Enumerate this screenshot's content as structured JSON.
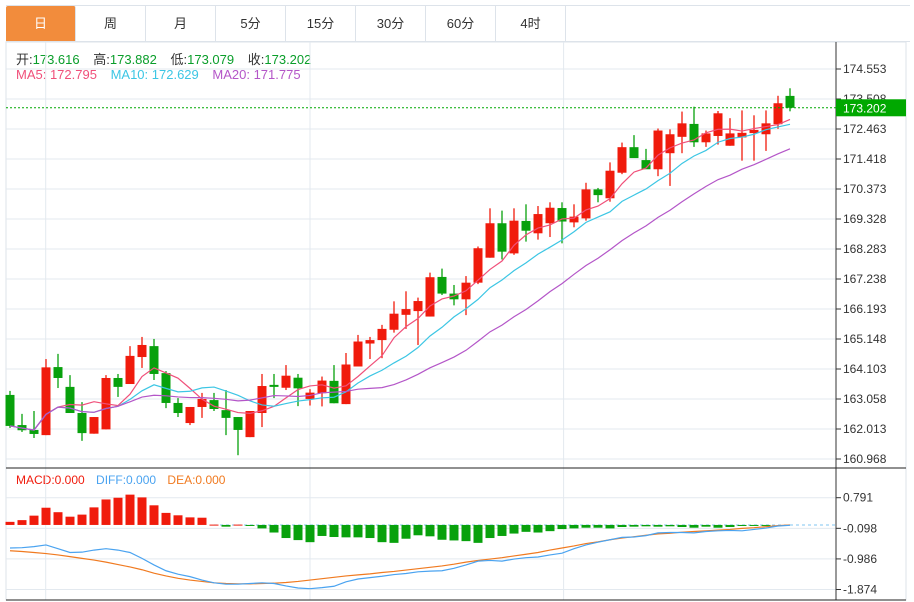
{
  "tabs": [
    "日",
    "周",
    "月",
    "5分",
    "15分",
    "30分",
    "60分",
    "4时"
  ],
  "active_tab": 0,
  "ohlc": {
    "open_label": "开:",
    "open": "173.616",
    "high_label": "高:",
    "high": "173.882",
    "low_label": "低:",
    "low": "173.079",
    "close_label": "收:",
    "close": "173.202"
  },
  "ma": {
    "ma5": "MA5: 172.795",
    "ma10": "MA10: 172.629",
    "ma20": "MA20: 171.775"
  },
  "macd_info": {
    "macd": "MACD:0.000",
    "diff": "DIFF:0.000",
    "dea": "DEA:0.000"
  },
  "colors": {
    "up": "#f01b0c",
    "down": "#08a10c",
    "ma5": "#f0507a",
    "ma10": "#3cc6e4",
    "ma20": "#b456c8",
    "diff": "#4aa3f0",
    "dea": "#f07a20",
    "accent": "#f28c3c",
    "price_tag": "#00a800"
  },
  "chart_data": {
    "type": "candlestick",
    "price_ticks": [
      "174.553",
      "173.508",
      "172.463",
      "171.418",
      "170.373",
      "169.328",
      "168.283",
      "167.238",
      "166.193",
      "165.148",
      "164.103",
      "163.058",
      "162.013",
      "160.968"
    ],
    "ylim": [
      160.968,
      174.553
    ],
    "last_price": "173.202",
    "candles": [
      [
        163.2,
        163.34,
        162.05,
        162.12
      ],
      [
        162.15,
        162.54,
        161.91,
        161.97
      ],
      [
        161.98,
        162.64,
        161.7,
        161.84
      ],
      [
        161.8,
        164.45,
        161.8,
        164.16
      ],
      [
        164.17,
        164.63,
        163.44,
        163.79
      ],
      [
        163.48,
        163.89,
        162.57,
        162.57
      ],
      [
        162.57,
        162.95,
        161.6,
        161.87
      ],
      [
        161.85,
        162.43,
        161.85,
        162.43
      ],
      [
        162.0,
        163.89,
        162.0,
        163.79
      ],
      [
        163.79,
        163.93,
        163.13,
        163.48
      ],
      [
        163.58,
        164.9,
        163.58,
        164.56
      ],
      [
        164.52,
        165.22,
        164.14,
        164.94
      ],
      [
        164.9,
        165.15,
        163.72,
        163.93
      ],
      [
        163.96,
        164.03,
        162.74,
        162.92
      ],
      [
        162.92,
        163.09,
        162.43,
        162.57
      ],
      [
        162.22,
        162.78,
        162.15,
        162.78
      ],
      [
        162.78,
        163.27,
        162.4,
        163.06
      ],
      [
        163.02,
        163.27,
        162.64,
        162.71
      ],
      [
        162.67,
        163.37,
        161.8,
        162.4
      ],
      [
        162.43,
        162.43,
        161.1,
        161.98
      ],
      [
        161.73,
        162.64,
        161.73,
        162.64
      ],
      [
        162.57,
        163.93,
        162.08,
        163.51
      ],
      [
        163.55,
        163.93,
        163.09,
        163.48
      ],
      [
        163.45,
        164.24,
        163.37,
        163.87
      ],
      [
        163.8,
        163.93,
        162.81,
        163.43
      ],
      [
        163.06,
        163.4,
        162.83,
        163.28
      ],
      [
        163.26,
        163.84,
        162.8,
        163.7
      ],
      [
        163.69,
        164.24,
        162.91,
        162.91
      ],
      [
        162.88,
        164.66,
        162.88,
        164.26
      ],
      [
        164.19,
        165.29,
        164.19,
        165.06
      ],
      [
        164.99,
        165.22,
        164.45,
        165.11
      ],
      [
        165.11,
        165.64,
        164.48,
        165.5
      ],
      [
        165.47,
        166.46,
        165.37,
        166.03
      ],
      [
        165.99,
        166.81,
        165.5,
        166.19
      ],
      [
        166.12,
        166.59,
        164.94,
        166.47
      ],
      [
        165.93,
        167.46,
        165.93,
        167.3
      ],
      [
        167.31,
        167.6,
        166.68,
        166.73
      ],
      [
        166.73,
        167.03,
        166.32,
        166.53
      ],
      [
        166.53,
        167.34,
        165.98,
        167.11
      ],
      [
        167.11,
        168.37,
        167.06,
        168.31
      ],
      [
        167.98,
        169.7,
        167.98,
        169.18
      ],
      [
        169.18,
        169.62,
        167.92,
        168.19
      ],
      [
        168.13,
        169.7,
        168.08,
        169.27
      ],
      [
        169.26,
        169.84,
        168.54,
        168.92
      ],
      [
        168.83,
        169.78,
        168.61,
        169.5
      ],
      [
        169.18,
        169.91,
        168.7,
        169.72
      ],
      [
        169.71,
        169.91,
        168.48,
        169.24
      ],
      [
        169.21,
        169.84,
        169.04,
        169.41
      ],
      [
        169.35,
        170.59,
        169.27,
        170.36
      ],
      [
        170.36,
        170.41,
        169.91,
        170.16
      ],
      [
        170.05,
        171.3,
        169.93,
        171.01
      ],
      [
        170.94,
        171.99,
        170.89,
        171.83
      ],
      [
        171.83,
        172.25,
        171.65,
        171.45
      ],
      [
        171.38,
        171.77,
        171.28,
        171.06
      ],
      [
        171.06,
        172.48,
        170.82,
        172.41
      ],
      [
        171.62,
        172.45,
        170.48,
        172.28
      ],
      [
        172.19,
        173.07,
        171.62,
        172.66
      ],
      [
        172.64,
        173.24,
        171.84,
        172.0
      ],
      [
        172.0,
        172.41,
        171.84,
        172.31
      ],
      [
        172.22,
        173.09,
        171.92,
        173.01
      ],
      [
        171.88,
        172.84,
        171.88,
        172.31
      ],
      [
        172.17,
        173.11,
        171.36,
        172.33
      ],
      [
        172.32,
        172.94,
        171.36,
        172.43
      ],
      [
        172.28,
        173.11,
        171.7,
        172.66
      ],
      [
        172.63,
        173.62,
        172.47,
        173.36
      ],
      [
        173.616,
        173.882,
        173.079,
        173.202
      ]
    ],
    "candle_fields": [
      "open",
      "high",
      "low",
      "close"
    ],
    "macd_ticks": [
      "0.791",
      "-0.098",
      "-0.986",
      "-1.874"
    ],
    "macd_hist": [
      0.09,
      0.14,
      0.27,
      0.5,
      0.37,
      0.24,
      0.3,
      0.51,
      0.74,
      0.79,
      0.88,
      0.8,
      0.57,
      0.35,
      0.28,
      0.22,
      0.21,
      0.01,
      -0.05,
      0.01,
      -0.03,
      -0.1,
      -0.22,
      -0.38,
      -0.44,
      -0.5,
      -0.32,
      -0.35,
      -0.36,
      -0.36,
      -0.38,
      -0.5,
      -0.52,
      -0.4,
      -0.3,
      -0.33,
      -0.43,
      -0.45,
      -0.47,
      -0.52,
      -0.38,
      -0.32,
      -0.25,
      -0.2,
      -0.22,
      -0.18,
      -0.12,
      -0.1,
      -0.08,
      -0.08,
      -0.1,
      -0.06,
      -0.05,
      -0.04,
      -0.05,
      -0.04,
      -0.06,
      -0.08,
      -0.05,
      -0.08,
      -0.06,
      -0.03,
      -0.02,
      -0.01,
      0.0,
      0.0
    ],
    "diff": [
      -0.67,
      -0.66,
      -0.63,
      -0.58,
      -0.69,
      -0.8,
      -0.79,
      -0.73,
      -0.69,
      -0.73,
      -0.8,
      -0.97,
      -1.16,
      -1.33,
      -1.43,
      -1.5,
      -1.6,
      -1.68,
      -1.72,
      -1.72,
      -1.7,
      -1.68,
      -1.7,
      -1.77,
      -1.83,
      -1.85,
      -1.82,
      -1.78,
      -1.65,
      -1.57,
      -1.53,
      -1.49,
      -1.44,
      -1.41,
      -1.36,
      -1.34,
      -1.33,
      -1.26,
      -1.16,
      -1.05,
      -1.03,
      -1.05,
      -0.99,
      -0.95,
      -0.93,
      -0.87,
      -0.82,
      -0.69,
      -0.58,
      -0.5,
      -0.43,
      -0.36,
      -0.35,
      -0.31,
      -0.23,
      -0.22,
      -0.22,
      -0.23,
      -0.19,
      -0.17,
      -0.16,
      -0.17,
      -0.13,
      -0.09,
      -0.03,
      -0.01
    ],
    "dea": [
      -0.75,
      -0.77,
      -0.8,
      -0.83,
      -0.87,
      -0.92,
      -0.97,
      -1.02,
      -1.08,
      -1.15,
      -1.22,
      -1.3,
      -1.4,
      -1.48,
      -1.55,
      -1.6,
      -1.64,
      -1.68,
      -1.7,
      -1.71,
      -1.71,
      -1.7,
      -1.69,
      -1.67,
      -1.64,
      -1.6,
      -1.56,
      -1.52,
      -1.48,
      -1.45,
      -1.42,
      -1.38,
      -1.35,
      -1.31,
      -1.27,
      -1.23,
      -1.19,
      -1.14,
      -1.08,
      -1.03,
      -0.99,
      -0.95,
      -0.9,
      -0.85,
      -0.8,
      -0.73,
      -0.67,
      -0.61,
      -0.54,
      -0.49,
      -0.43,
      -0.38,
      -0.34,
      -0.3,
      -0.26,
      -0.24,
      -0.21,
      -0.19,
      -0.17,
      -0.15,
      -0.13,
      -0.1,
      -0.08,
      -0.05,
      -0.02,
      0.0
    ],
    "macd_ylim": [
      -1.874,
      0.791
    ]
  }
}
